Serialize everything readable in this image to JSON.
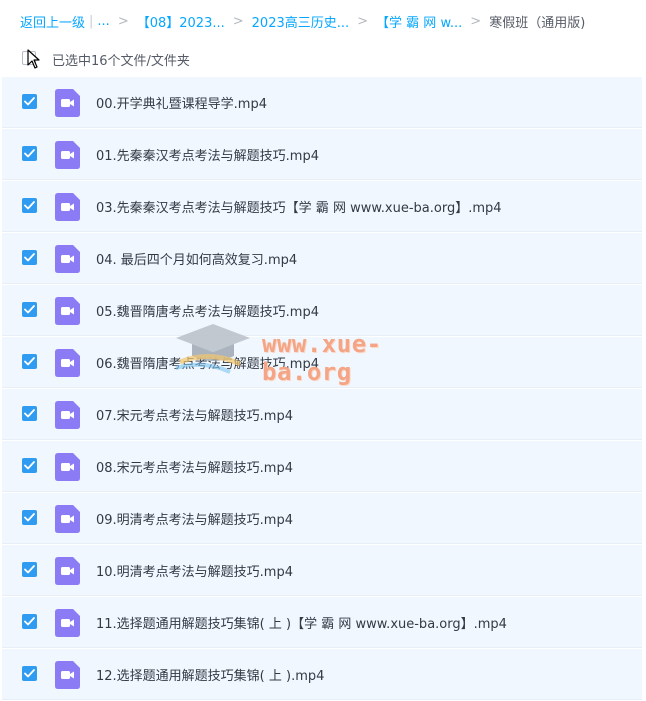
{
  "breadcrumb": {
    "back": "返回上一级",
    "ellipsis": "...",
    "items": [
      "【08】2023...",
      "2023高三历史...",
      "【学 霸 网 w..."
    ],
    "current": "寒假班（通用版)"
  },
  "selection": {
    "label": "已选中16个文件/文件夹"
  },
  "files": [
    {
      "name": "00.开学典礼暨课程导学.mp4"
    },
    {
      "name": "01.先秦秦汉考点考法与解题技巧.mp4"
    },
    {
      "name": "03.先秦秦汉考点考法与解题技巧【学 霸 网 www.xue-ba.org】.mp4"
    },
    {
      "name": "04. 最后四个月如何高效复习.mp4"
    },
    {
      "name": "05.魏晋隋唐考点考法与解题技巧.mp4"
    },
    {
      "name": "06.魏晋隋唐考点考法与解题技巧.mp4"
    },
    {
      "name": "07.宋元考点考法与解题技巧.mp4"
    },
    {
      "name": "08.宋元考点考法与解题技巧.mp4"
    },
    {
      "name": "09.明清考点考法与解题技巧.mp4"
    },
    {
      "name": "10.明清考点考法与解题技巧.mp4"
    },
    {
      "name": "11.选择题通用解题技巧集锦( 上 )【学 霸 网 www.xue-ba.org】.mp4"
    },
    {
      "name": "12.选择题通用解题技巧集锦( 上 ).mp4"
    }
  ],
  "watermark": {
    "text": "www.xue-ba.org"
  },
  "colors": {
    "accent": "#06a7ff",
    "checkbox": "#2f9bf1",
    "video_icon": "#8b7cf6",
    "row_bg": "#f1f7fe"
  }
}
